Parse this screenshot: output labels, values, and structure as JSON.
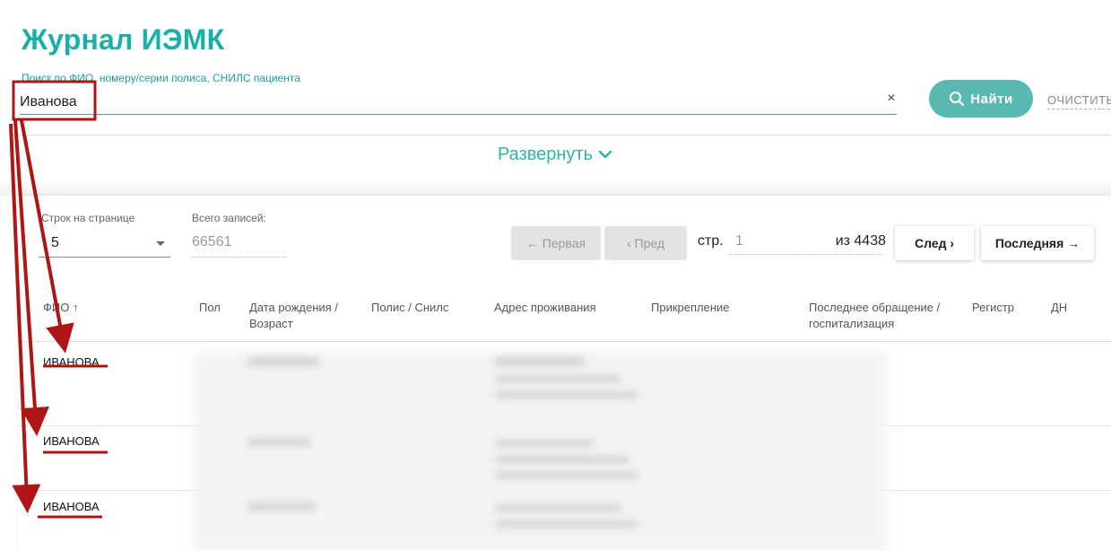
{
  "header": {
    "title": "Журнал ИЭМК",
    "search_label": "Поиск по ФИО, номеру/серии полиса, СНИЛС пациента",
    "search_value": "Иванова",
    "clear_icon": "×",
    "find_label": "Найти",
    "clear_label": "ОЧИСТИТЬ",
    "expand_label": "Развернуть"
  },
  "pagination": {
    "rows_label": "Строк на странице",
    "rows_value": "5",
    "total_label": "Всего записей:",
    "total_value": "66561",
    "first_label": "← Первая",
    "prev_label": "‹  Пред",
    "page_label": "стр.",
    "page_value": "1",
    "of_total": "из 4438",
    "next_label": "След  ›",
    "last_label": "Последняя →"
  },
  "table": {
    "columns": [
      "ФИО ↑",
      "Пол",
      "Дата рождения / Возраст",
      "Полис / Снилс",
      "Адрес проживания",
      "Прикрепление",
      "Последнее обращение / госпитализация",
      "Регистр",
      "ДН"
    ],
    "rows": [
      {
        "fio": "ИВАНОВА"
      },
      {
        "fio": "ИВАНОВА"
      },
      {
        "fio": "ИВАНОВА"
      }
    ]
  },
  "colors": {
    "accent": "#1ab0a8",
    "button": "#58b9b2",
    "annotation": "#b01515"
  },
  "icons": {
    "search": "search-icon",
    "chevron": "chevron-down-icon",
    "clear": "close-icon"
  }
}
